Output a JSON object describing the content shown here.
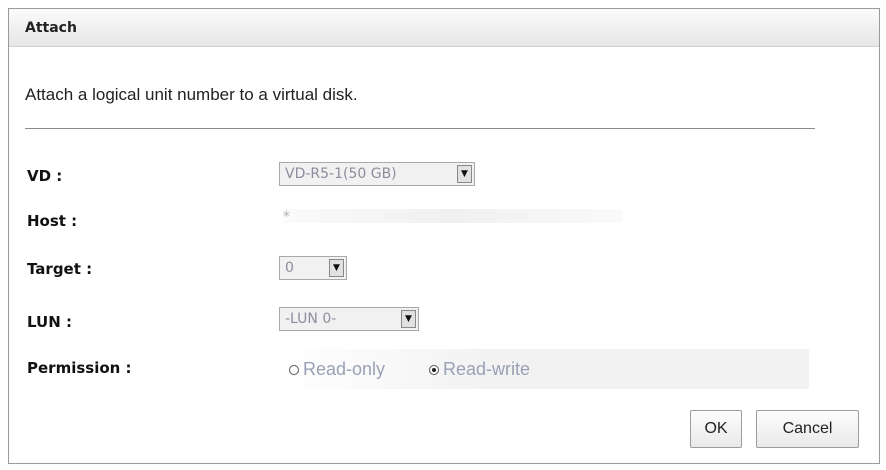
{
  "dialog": {
    "title": "Attach",
    "description": "Attach a logical unit number to a virtual disk."
  },
  "fields": {
    "vd": {
      "label": "VD :",
      "value": "VD-R5-1(50 GB)"
    },
    "host": {
      "label": "Host :",
      "value": "*"
    },
    "target": {
      "label": "Target :",
      "value": "0"
    },
    "lun": {
      "label": "LUN :",
      "value": "-LUN 0-"
    },
    "permission": {
      "label": "Permission :",
      "options": [
        {
          "label": "Read-only",
          "selected": false
        },
        {
          "label": "Read-write",
          "selected": true
        }
      ]
    }
  },
  "buttons": {
    "ok": "OK",
    "cancel": "Cancel"
  },
  "icons": {
    "dropdown": "chevron-down-icon",
    "radio_unchecked": "radio-unchecked-icon",
    "radio_checked": "radio-checked-icon"
  }
}
